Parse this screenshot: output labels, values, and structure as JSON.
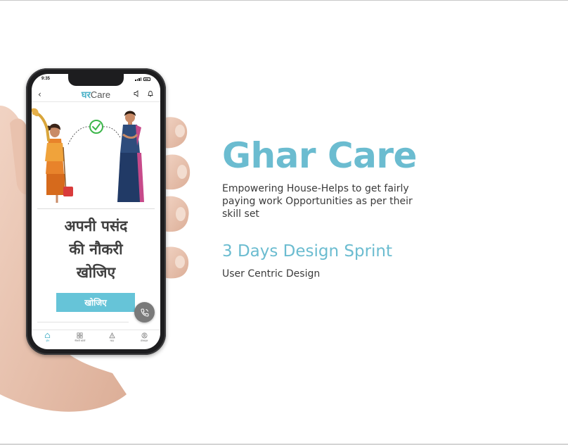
{
  "hero": {
    "title": "Ghar Care",
    "tagline": "Empowering House-Helps to get fairly paying work Opportunities as per their skill set",
    "sprint": "3 Days Design Sprint",
    "subtitle": "User Centric Design"
  },
  "phone": {
    "status_time": "9:35",
    "logo_part1": "घर",
    "logo_part2": "Care",
    "headline_line1": "अपनी पसंद",
    "headline_line2": "की नौकरी",
    "headline_line3": "खोजिए",
    "cta_label": "खोजिए",
    "nav": [
      {
        "label": "होम",
        "icon": "home-icon"
      },
      {
        "label": "नौकरी खोजें",
        "icon": "grid-icon"
      },
      {
        "label": "मदद",
        "icon": "alert-icon"
      },
      {
        "label": "प्रोफाइल",
        "icon": "profile-icon"
      }
    ]
  },
  "colors": {
    "accent": "#6bbcd0",
    "button": "#66c4d8",
    "text": "#3b3b3b"
  }
}
